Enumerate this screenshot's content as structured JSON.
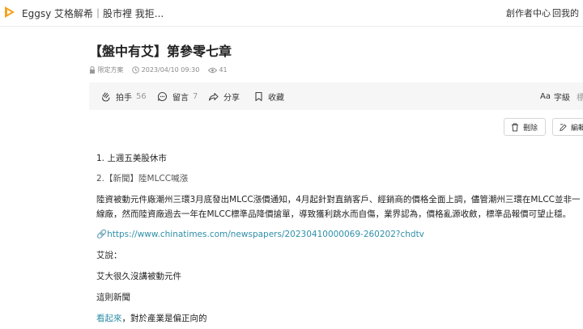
{
  "topbar": {
    "site_title": "Eggsy 艾格解希｜股市裡 我拒...",
    "nav_creator": "創作者中心",
    "nav_home": "回我的",
    "brand_color": "#f5a21b"
  },
  "article": {
    "title": "【盤中有艾】第參零七章",
    "meta": {
      "access": "限定方案",
      "date": "2023/04/10 09:30",
      "views": "41"
    }
  },
  "actions": {
    "clap_label": "拍手",
    "clap_count": "56",
    "comment_label": "留言",
    "comment_count": "7",
    "share_label": "分享",
    "bookmark_label": "收藏",
    "font_label": "字級",
    "font_extra": "標準"
  },
  "buttons": {
    "delete_label": "刪除",
    "edit_label": "編輯"
  },
  "content": {
    "item1": "1. 上週五美股休市",
    "item2": "2.【新聞】陸MLCC喊漲",
    "para1": "陸資被動元件廠潮州三環3月底發出MLCC漲價通知，4月起針對直銷客戶、經銷商的價格全面上調，儘管潮州三環在MLCC並非一線廠，然而陸資廠過去一年在MLCC標準品降價搶單，導致獲利跳水而自傷，業界認為，價格亂源收斂，標準品報價可望止穩。",
    "url": "https://www.chinatimes.com/newspapers/20230410000069-260202?chdtv",
    "ai_says": "艾說：",
    "line1": "艾大很久沒講被動元件",
    "line2": "這則新聞",
    "line3_link": "看起來",
    "line3_rest": "，對於產業是偏正向的"
  }
}
